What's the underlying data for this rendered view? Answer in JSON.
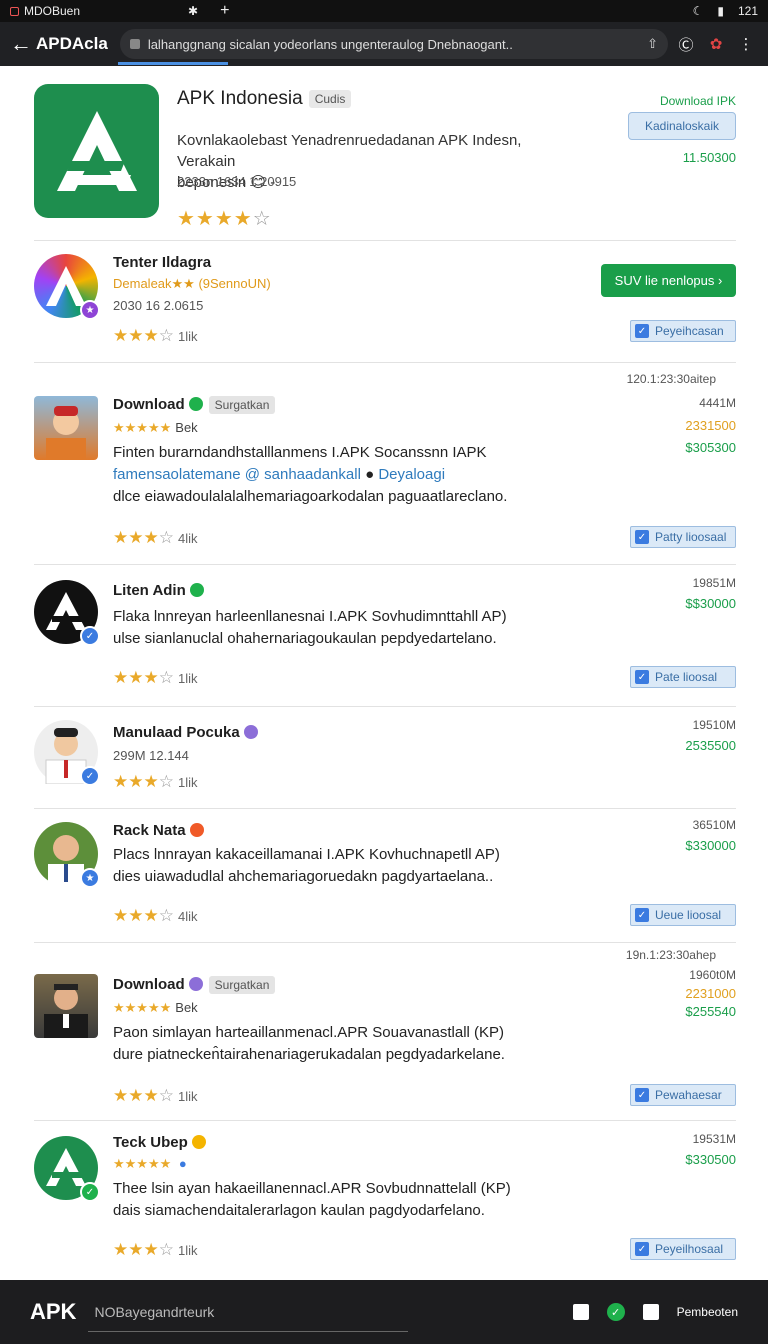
{
  "status": {
    "app_title": "MDOBuen",
    "time": "121"
  },
  "browser": {
    "site": "APDAcla",
    "url": "lalhanggnang  sicalan yodeorlans  ungenteraulog  Dnebnaogant..",
    "colors": {
      "toolbar": "#202124",
      "accent": "#4a90e2"
    }
  },
  "hero": {
    "title": "APK Indonesia",
    "badge": "Cudis",
    "desc_line1": "Kovnlakaolebast Yenadrenruedadanan APK Indesn, Verakain",
    "desc_line2": "beponesin",
    "meta": "2233n 1634  1 20915",
    "download_label": "Download IPK",
    "download_button": "Kadinaloskaik",
    "download_size": "11.50300",
    "rating": 3.5
  },
  "items": [
    {
      "name": "Tenter Ildagra",
      "sub": "Demaleak★★ (9SennoUN)",
      "meta": "2030  16  2.0615",
      "count": "1lik",
      "action": "SUV lie nenlopus ›",
      "button": "Peyeihcasan"
    },
    {
      "name": "Download",
      "pill": "Surgatkan",
      "review": "Bek",
      "timestamp": "120.1:23:30aitep",
      "size": "4441M",
      "price1": "2331500",
      "price2": "$305300",
      "line1": "Finten burarndandhstalllanmens I.APK Socanssnn IAPK",
      "line2a": "famensaolatemane",
      "line2b": "@ sanhaadankall",
      "line2c": "Deyaloagi",
      "line3": "dlce eiawadoulalalalhemariagoarkodalan paguaatlareclano.",
      "count": "4lik",
      "button": "Patty lioosaal"
    },
    {
      "name": "Liten Adin",
      "size": "19851M",
      "price": "$$30000",
      "line1": "Flaka lnnreyan harleenllanesnai I.APK Sovhudimnttahll AP)",
      "line2": "ulse sianlanuclal ohahernariagoukaulan pepdyedartelano.",
      "count": "1lik",
      "button": "Pate lioosal"
    },
    {
      "name": "Manulaad Pocuka",
      "meta": "299M  12.144",
      "size": "19510M",
      "price": "2535500",
      "count": "1lik"
    },
    {
      "name": "Rack Nata",
      "size": "36510M",
      "price": "$330000",
      "line1": "Placs lnnrayan kakaceillamanai I.APK Kovhuchnapetll AP)",
      "line2": "dies uiawadudlal ahchemariagoruedakn pagdyartaelana..",
      "count": "4lik",
      "button": "Ueue lioosal"
    },
    {
      "name": "Download",
      "pill": "Surgatkan",
      "review": "Bek",
      "timestamp": "19n.1:23:30ahep",
      "size": "1960t0M",
      "price1": "2231000",
      "price2": "$255540",
      "line1": "Paon simlayan harteaillanmenacl.APR Souavanastlall (KP)",
      "line2": "dure piatnecken̂tairahenariagerukadalan pegdyadarkelane.",
      "count": "1lik",
      "button": "Pewahaesar"
    },
    {
      "name": "Teck Ubep",
      "size": "19531M",
      "price": "$330500",
      "line1": "Thee lsin ayan hakaeillanennacl.APR Sovbudnnattelall (KP)",
      "line2": "dais siamachendaitalerarlagon kaulan pagdyodarfelano.",
      "count": "1lik",
      "button": "Peyeilhosaal"
    }
  ],
  "bottom": {
    "logo": "APK",
    "input_placeholder": "NOBayegandrteurk",
    "action_label": "Pembeoten"
  }
}
